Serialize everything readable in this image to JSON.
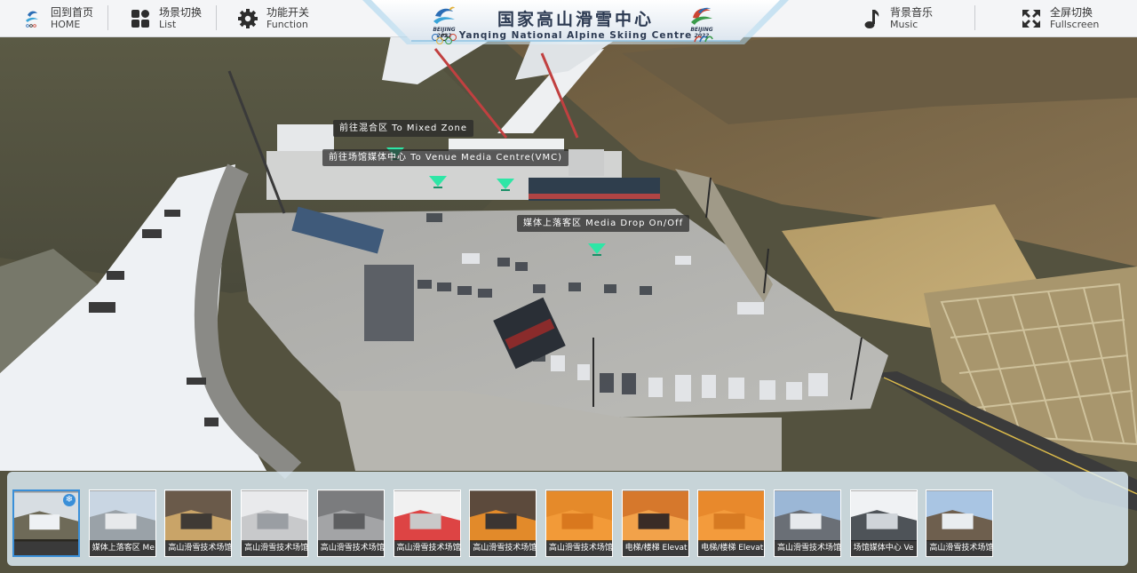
{
  "nav": {
    "home": {
      "cn": "回到首页",
      "en": "HOME",
      "icon": "home-emblem-icon"
    },
    "list": {
      "cn": "场景切换",
      "en": "List",
      "icon": "grid-icon"
    },
    "function": {
      "cn": "功能开关",
      "en": "Function",
      "icon": "gear-icon"
    },
    "music": {
      "cn": "背景音乐",
      "en": "Music",
      "icon": "music-note-icon"
    },
    "fullscreen": {
      "cn": "全屏切换",
      "en": "Fullscreen",
      "icon": "expand-icon"
    }
  },
  "title": {
    "cn": "国家高山滑雪中心",
    "en": "Yanqing National Alpine Skiing Centre",
    "logo_text": "BEIJING 2022"
  },
  "hotspots": [
    {
      "label": "前往混合区 To Mixed Zone"
    },
    {
      "label": "前往场馆媒体中心 To Venue Media Centre(VMC)"
    },
    {
      "label": "媒体上落客区 Media Drop On/Off"
    }
  ],
  "thumbnails": [
    {
      "caption": "",
      "active": true
    },
    {
      "caption": "媒体上落客区 Me",
      "active": false
    },
    {
      "caption": "高山滑雪技术场馆",
      "active": false
    },
    {
      "caption": "高山滑雪技术场馆",
      "active": false
    },
    {
      "caption": "高山滑雪技术场馆",
      "active": false
    },
    {
      "caption": "高山滑雪技术场馆",
      "active": false
    },
    {
      "caption": "高山滑雪技术场馆",
      "active": false
    },
    {
      "caption": "高山滑雪技术场馆",
      "active": false
    },
    {
      "caption": "电梯/楼梯 Elevat",
      "active": false
    },
    {
      "caption": "电梯/楼梯 Elevat",
      "active": false
    },
    {
      "caption": "高山滑雪技术场馆",
      "active": false
    },
    {
      "caption": "场馆媒体中心 Ve",
      "active": false
    },
    {
      "caption": "高山滑雪技术场馆",
      "active": false
    }
  ],
  "colors": {
    "accent": "#3a8fd8",
    "hotspot_arrow": "#2ee6a6",
    "topbar": "#f4f5f7"
  }
}
